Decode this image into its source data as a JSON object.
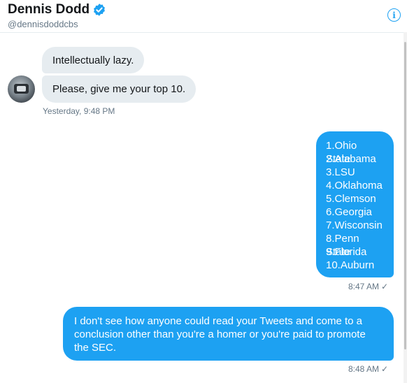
{
  "header": {
    "name": "Dennis Dodd",
    "handle": "@dennisdoddcbs"
  },
  "colors": {
    "accent": "#1da1f2",
    "received_bubble": "#e6ecf0",
    "meta_text": "#657786"
  },
  "icons": {
    "verified": "verified-badge-icon",
    "info": "info-icon",
    "read_receipt": "checkmark-icon"
  },
  "conversation": {
    "received": [
      {
        "text": "Intellectually lazy."
      },
      {
        "text": "Please, give me your top 10."
      }
    ],
    "received_time": "Yesterday, 9:48 PM",
    "sent_list": [
      "1.Ohio State",
      "2.Alabama",
      "3.LSU",
      "4.Oklahoma",
      "5.Clemson",
      "6.Georgia",
      "7.Wisconsin",
      "8.Penn State",
      "9.Florida",
      "10.Auburn"
    ],
    "sent_list_time": "8:47 AM",
    "sent_message": "I don't see how anyone could read your Tweets and come to a conclusion other than you're a homer or you're paid to promote the SEC.",
    "sent_message_time": "8:48 AM",
    "check": "✓"
  }
}
